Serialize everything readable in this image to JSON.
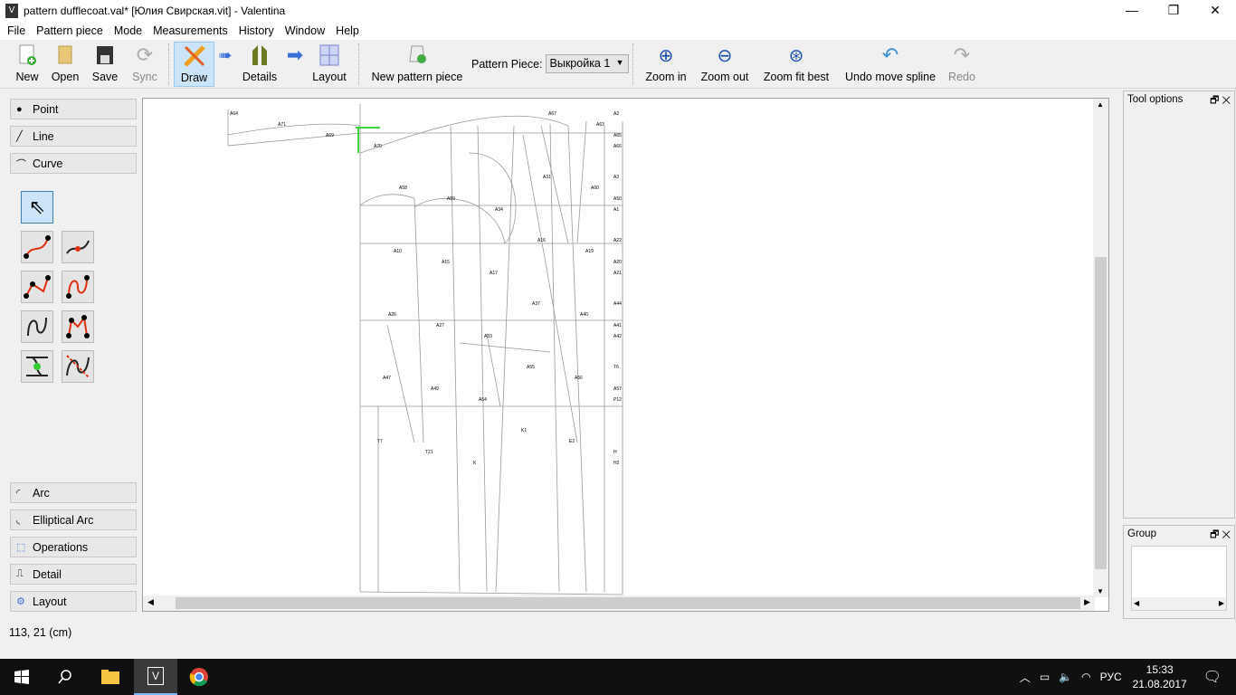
{
  "window": {
    "title": "pattern dufflecoat.val* [Юлия Свирская.vit] - Valentina",
    "icon": "valentina-icon"
  },
  "menu": [
    "File",
    "Pattern piece",
    "Mode",
    "Measurements",
    "History",
    "Window",
    "Help"
  ],
  "toolbar": {
    "new": "New",
    "open": "Open",
    "save": "Save",
    "sync": "Sync",
    "draw": "Draw",
    "details": "Details",
    "layout": "Layout",
    "new_piece": "New pattern piece",
    "pattern_piece_label": "Pattern Piece:",
    "pattern_piece_value": "Выкройка 1",
    "zoom_in": "Zoom in",
    "zoom_out": "Zoom out",
    "zoom_fit": "Zoom fit best",
    "undo": "Undo move spline",
    "redo": "Redo"
  },
  "left": {
    "point": "Point",
    "line": "Line",
    "curve": "Curve",
    "arc": "Arc",
    "elliptical_arc": "Elliptical Arc",
    "operations": "Operations",
    "detail": "Detail",
    "layout": "Layout"
  },
  "docks": {
    "tool_options": "Tool options",
    "group": "Group"
  },
  "canvas": {
    "labels": [
      "A64",
      "A71",
      "A69",
      "A70",
      "A67",
      "A63",
      "A65",
      "A66",
      "A2",
      "A58",
      "A59",
      "A34",
      "A31",
      "A60",
      "A50",
      "A1",
      "A3",
      "A10",
      "A15",
      "A17",
      "A16",
      "A19",
      "A20",
      "A21",
      "A22",
      "A26",
      "A27",
      "A33",
      "A37",
      "A40",
      "A41",
      "A42",
      "A44",
      "A47",
      "A49",
      "A54",
      "A55",
      "A56",
      "A57",
      "P12",
      "T6",
      "T7",
      "T21",
      "K",
      "K1",
      "E2",
      "H",
      "H2"
    ]
  },
  "status": "113, 21 (cm)",
  "taskbar": {
    "lang": "РУС",
    "time": "15:33",
    "date": "21.08.2017"
  },
  "colors": {
    "accent": "#0078d7",
    "selected": "#cce4f7",
    "highlight": "#00cc00"
  }
}
